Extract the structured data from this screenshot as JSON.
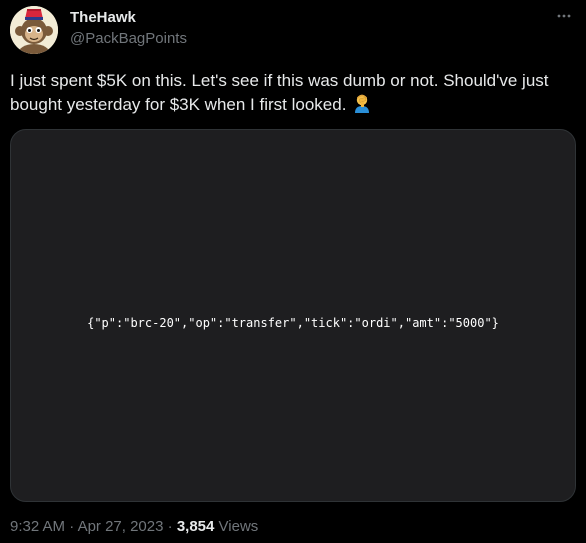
{
  "author": {
    "display_name": "TheHawk",
    "handle": "@PackBagPoints"
  },
  "icons": {
    "more": "more-horizontal-icon",
    "avatar": "monkey-with-fez-avatar",
    "emoji": "facepalm-emoji"
  },
  "tweet": {
    "text": "I just spent $5K on this. Let's see if this was dumb or not. Should've just bought yesterday for $3K when I first looked."
  },
  "media": {
    "inscription": "{\"p\":\"brc-20\",\"op\":\"transfer\",\"tick\":\"ordi\",\"amt\":\"5000\"}"
  },
  "meta": {
    "time": "9:32 AM",
    "separator": "·",
    "date": "Apr 27, 2023",
    "views_count": "3,854",
    "views_label": "Views"
  },
  "colors": {
    "background": "#000000",
    "primary_text": "#e7e9ea",
    "secondary_text": "#71767b",
    "media_background": "#1e1e20",
    "border": "#2f3336"
  }
}
